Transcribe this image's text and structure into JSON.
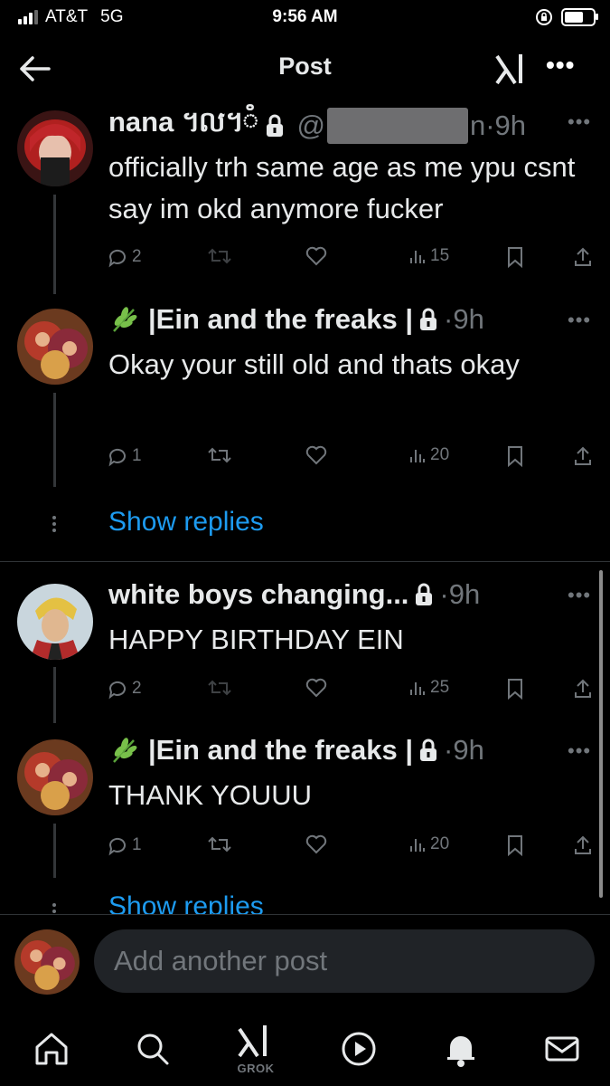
{
  "status_bar": {
    "carrier": "AT&T",
    "network": "5G",
    "time": "9:56 AM",
    "battery_level": 0.75
  },
  "header": {
    "title": "Post",
    "back_icon": "arrow-left-icon",
    "logo_icon": "xai-logo-icon",
    "more_icon": "more-horizontal-icon"
  },
  "posts": [
    {
      "name": "nana ៘៓",
      "handle_prefix": "@",
      "handle_suffix": "n",
      "time": "·9h",
      "text": "officially trh same age as me  ypu csnt say im okd anymore fucker",
      "replies": "2",
      "reposts": "",
      "likes": "",
      "views": "15"
    },
    {
      "name": "|Ein and the freaks |",
      "time": "·9h",
      "text": "Okay your still old and thats okay",
      "replies": "1",
      "reposts": "",
      "likes": "",
      "views": "20"
    },
    {
      "name": "white boys changing...",
      "time": "·9h",
      "text": "HAPPY BIRTHDAY EIN",
      "replies": "2",
      "reposts": "",
      "likes": "",
      "views": "25"
    },
    {
      "name": "|Ein and the freaks |",
      "time": "·9h",
      "text": "THANK YOUUU",
      "replies": "1",
      "reposts": "",
      "likes": "",
      "views": "20"
    }
  ],
  "show_replies": [
    "Show replies",
    "Show replies"
  ],
  "composer": {
    "placeholder": "Add another post"
  },
  "tabbar": {
    "items": [
      "home-icon",
      "search-icon",
      "grok-icon",
      "video-icon",
      "notifications-icon",
      "messages-icon"
    ],
    "grok_label": "GROK"
  },
  "colors": {
    "background": "#000000",
    "text": "#e7e9ea",
    "muted": "#71767b",
    "accent": "#1d9bf0",
    "input_bg": "#202327"
  }
}
